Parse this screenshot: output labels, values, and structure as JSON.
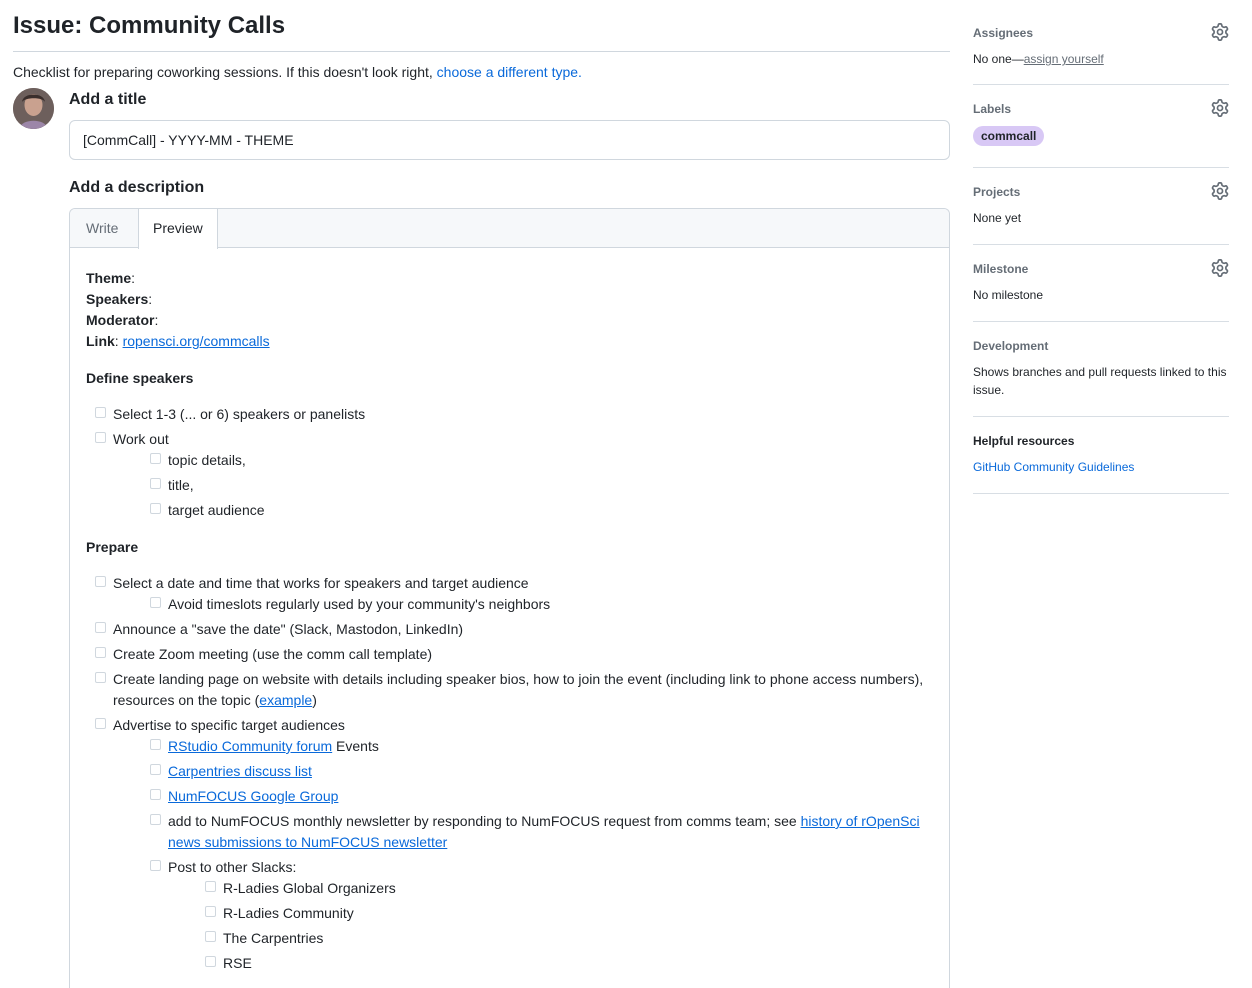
{
  "page": {
    "title": "Issue: Community Calls",
    "template_note": "Checklist for preparing coworking sessions. If this doesn't look right, ",
    "template_link": "choose a different type."
  },
  "form": {
    "title_label": "Add a title",
    "title_value": "[CommCall] - YYYY-MM - THEME",
    "description_label": "Add a description",
    "tabs": [
      "Write",
      "Preview"
    ],
    "active_tab": "Preview"
  },
  "preview": {
    "meta": [
      {
        "key": "Theme",
        "value": ""
      },
      {
        "key": "Speakers",
        "value": ""
      },
      {
        "key": "Moderator",
        "value": ""
      },
      {
        "key": "Link",
        "link": "ropensci.org/commcalls"
      }
    ],
    "sections": [
      {
        "heading": "Define speakers",
        "tasks": [
          {
            "text": "Select 1-3 (... or 6) speakers or panelists"
          },
          {
            "text": "Work out",
            "children": [
              {
                "text": "topic details,"
              },
              {
                "text": "title,"
              },
              {
                "text": "target audience"
              }
            ]
          }
        ]
      },
      {
        "heading": "Prepare",
        "tasks": [
          {
            "text": "Select a date and time that works for speakers and target audience",
            "children": [
              {
                "text": "Avoid timeslots regularly used by your community's neighbors"
              }
            ]
          },
          {
            "text": "Announce a \"save the date\" (Slack, Mastodon, LinkedIn)"
          },
          {
            "text": "Create Zoom meeting (use the comm call template)"
          },
          {
            "text": "Create landing page on website with details including speaker bios, how to join the event (including link to phone access numbers), resources on the topic (",
            "link": "example",
            "after": ")"
          },
          {
            "text": "Advertise to specific target audiences",
            "children": [
              {
                "link": "RStudio Community forum",
                "after": " Events"
              },
              {
                "link": "Carpentries discuss list"
              },
              {
                "link": "NumFOCUS Google Group"
              },
              {
                "text": "add to NumFOCUS monthly newsletter by responding to NumFOCUS request from comms team; see ",
                "link": "history of rOpenSci news submissions to NumFOCUS newsletter"
              },
              {
                "text": "Post to other Slacks:",
                "children": [
                  {
                    "text": "R-Ladies Global Organizers"
                  },
                  {
                    "text": "R-Ladies Community"
                  },
                  {
                    "text": "The Carpentries"
                  },
                  {
                    "text": "RSE"
                  }
                ]
              }
            ]
          }
        ]
      }
    ]
  },
  "sidebar": {
    "assignees": {
      "heading": "Assignees",
      "value_prefix": "No one—",
      "value_link": "assign yourself"
    },
    "labels": {
      "heading": "Labels",
      "items": [
        "commcall"
      ],
      "pill_color": "#d8c8f5"
    },
    "projects": {
      "heading": "Projects",
      "value": "None yet"
    },
    "milestone": {
      "heading": "Milestone",
      "value": "No milestone"
    },
    "development": {
      "heading": "Development",
      "value": "Shows branches and pull requests linked to this issue."
    },
    "resources": {
      "heading": "Helpful resources",
      "link": "GitHub Community Guidelines"
    }
  },
  "colors": {
    "link": "#0969da",
    "border": "#d0d7de",
    "muted": "#656d76",
    "label_pill": "#d8c8f5"
  },
  "icons": {
    "gear": "gear-icon",
    "avatar": "user-avatar"
  }
}
